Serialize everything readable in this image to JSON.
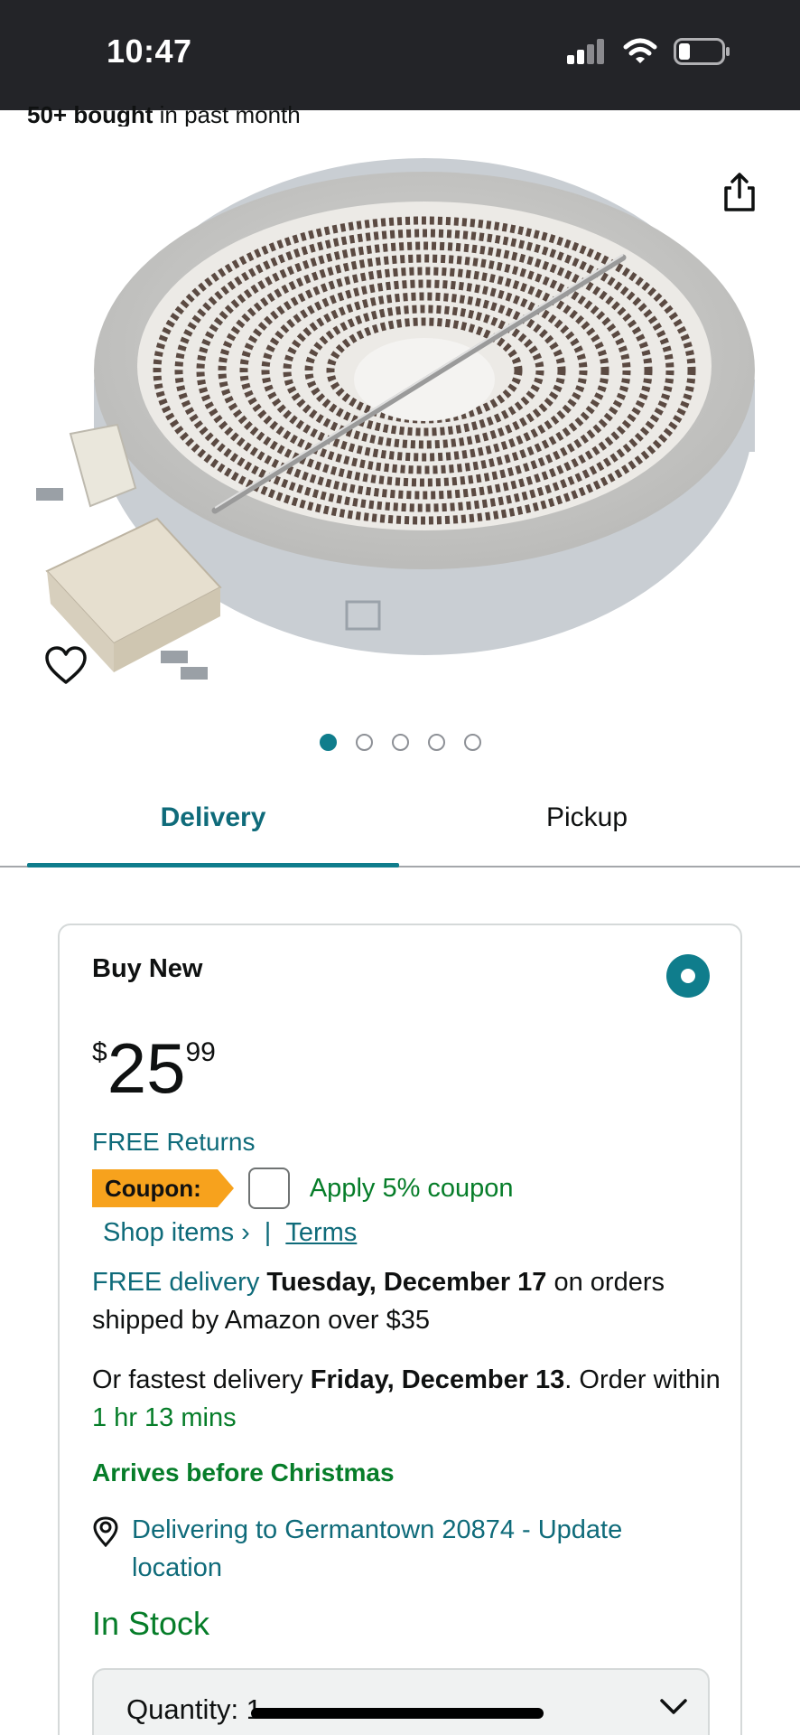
{
  "status_bar": {
    "time": "10:47"
  },
  "product": {
    "bought_bold": "50+ bought",
    "bought_rest": " in past month",
    "image_count": 5,
    "active_image": 1
  },
  "tabs": {
    "delivery": "Delivery",
    "pickup": "Pickup"
  },
  "buy_box": {
    "title": "Buy New",
    "price_symbol": "$",
    "price_whole": "25",
    "price_fraction": "99",
    "free_returns": "FREE Returns",
    "coupon_label": "Coupon:",
    "coupon_text": "Apply 5% coupon",
    "shop_items": "Shop items ›",
    "separator": "|",
    "terms": "Terms",
    "delivery_free": "FREE delivery",
    "delivery_date": "Tuesday, December 17",
    "delivery_rest": "on orders shipped by Amazon over $35",
    "fastest_prefix": "Or fastest delivery",
    "fastest_date": "Friday, December 13",
    "fastest_mid": ". Order within",
    "fastest_time": "1 hr 13 mins",
    "christmas": "Arrives before Christmas",
    "location": "Delivering to Germantown 20874 - Update location",
    "stock": "In Stock",
    "quantity": "Quantity: 1"
  },
  "colors": {
    "accent": "#0f7d8c",
    "link": "#0f6b7a",
    "green": "#067d29",
    "coupon": "#f7a21d",
    "status_bar": "#232428"
  }
}
